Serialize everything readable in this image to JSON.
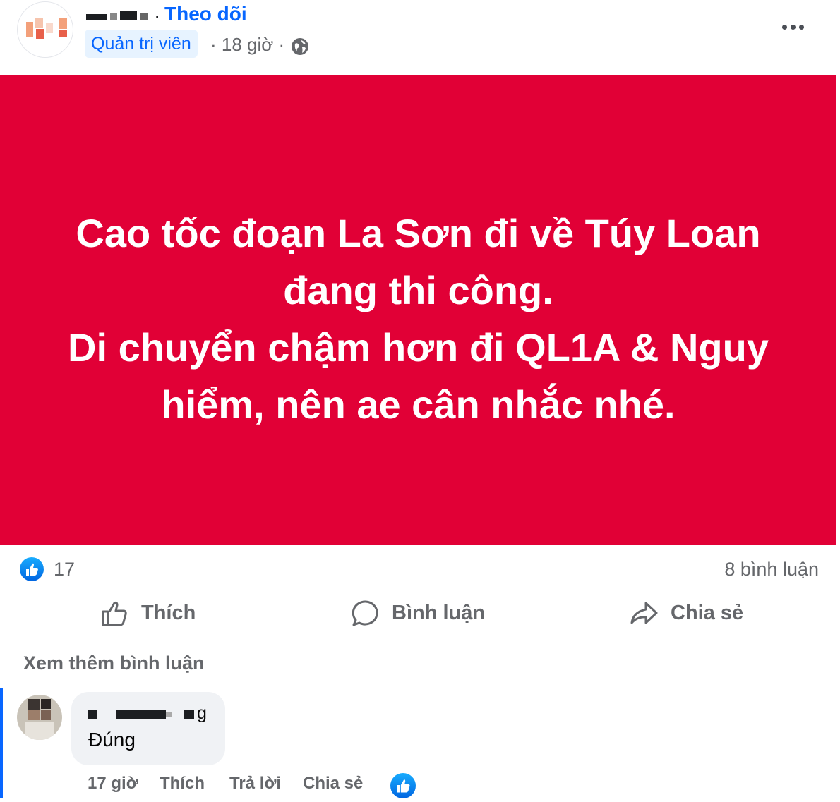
{
  "header": {
    "follow_label": "Theo dõi",
    "role_badge": "Quản trị viên",
    "time": "· 18 giờ ·",
    "privacy_icon": "globe-icon",
    "more_icon": "more-horizontal-icon"
  },
  "post": {
    "background_color": "#e10036",
    "lines": [
      "Cao tốc đoạn La Sơn đi về Túy Loan",
      "đang thi công.",
      "Di chuyển chậm hơn đi QL1A & Nguy",
      "hiểm, nên ae cân nhắc nhé."
    ]
  },
  "stats": {
    "reaction_icon": "like-reaction-icon",
    "reaction_count": "17",
    "comment_count": "8 bình luận"
  },
  "actions": {
    "like": "Thích",
    "comment": "Bình luận",
    "share": "Chia sẻ"
  },
  "comments_section": {
    "view_more": "Xem thêm bình luận",
    "comment": {
      "author_suffix": "g",
      "text": "Đúng",
      "time": "17 giờ",
      "like": "Thích",
      "reply": "Trả lời",
      "share": "Chia sẻ"
    }
  },
  "colors": {
    "accent": "#0866ff",
    "muted_text": "#65676b"
  }
}
